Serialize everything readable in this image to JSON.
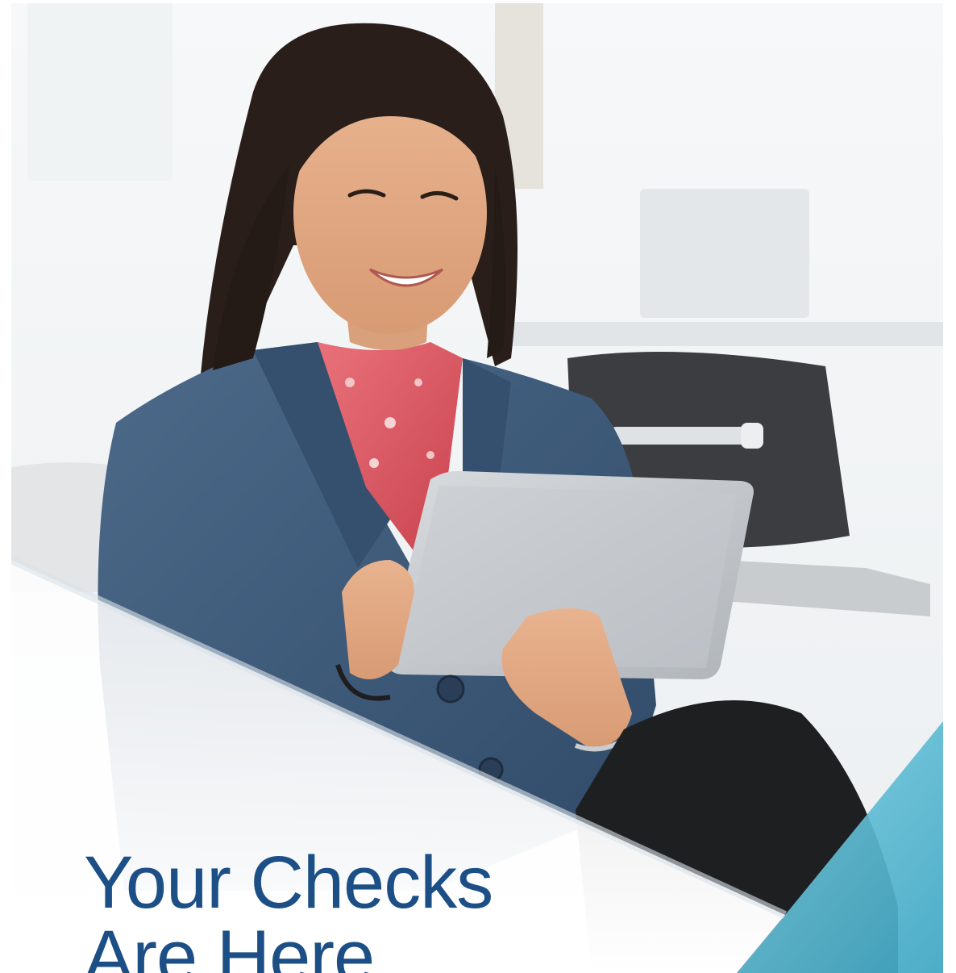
{
  "document": {
    "headline_line1": "Your Checks",
    "headline_line2": "Are Here"
  },
  "colors": {
    "headline": "#1c4f86",
    "accent_teal": "#5bbfd6",
    "jacket": "#3e5a7a",
    "background": "#ffffff"
  },
  "images": {
    "hero": "woman-using-tablet-photo"
  }
}
